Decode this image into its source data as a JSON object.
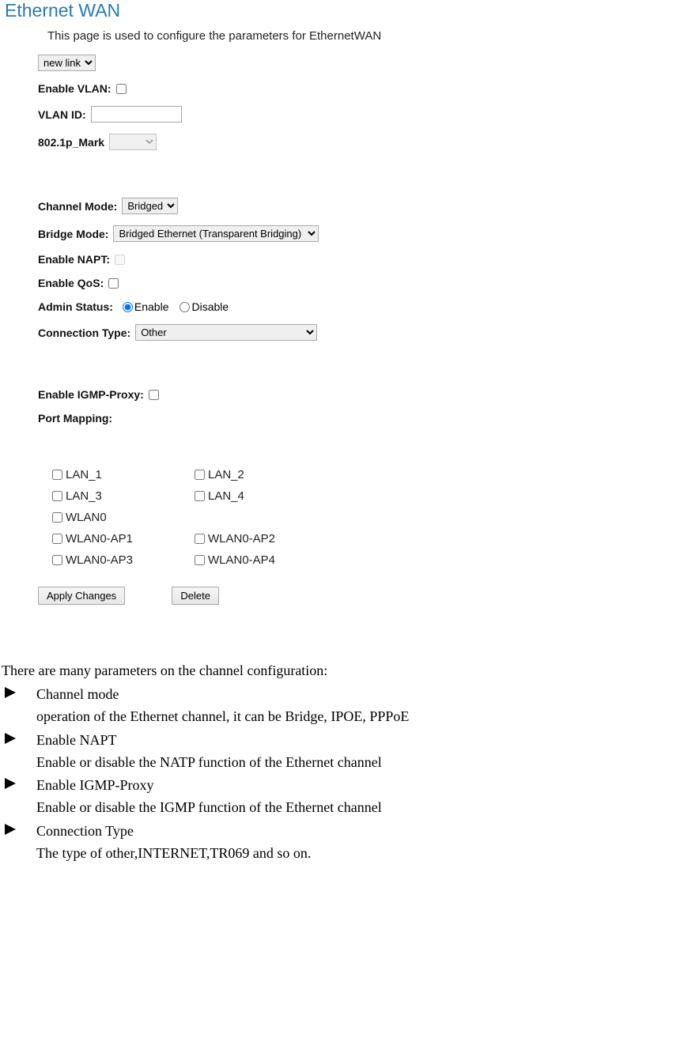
{
  "title": "Ethernet WAN",
  "description": "This page is used to configure the parameters for EthernetWAN",
  "link_select": {
    "selected": "new link"
  },
  "fields": {
    "enable_vlan_label": "Enable VLAN:",
    "vlan_id_label": "VLAN ID:",
    "mark_label": "802.1p_Mark",
    "channel_mode_label": "Channel Mode:",
    "channel_mode_value": "Bridged",
    "bridge_mode_label": "Bridge Mode:",
    "bridge_mode_value": "Bridged Ethernet (Transparent Bridging)",
    "enable_napt_label": "Enable NAPT:",
    "enable_qos_label": "Enable QoS:",
    "admin_status_label": "Admin Status:",
    "admin_enable": "Enable",
    "admin_disable": "Disable",
    "connection_type_label": "Connection Type:",
    "connection_type_value": "Other",
    "igmp_label": "Enable IGMP-Proxy:",
    "port_mapping_label": "Port Mapping:"
  },
  "port_mapping": {
    "r1c1": "LAN_1",
    "r1c2": "LAN_2",
    "r2c1": "LAN_3",
    "r2c2": "LAN_4",
    "r3c1": "WLAN0",
    "r4c1": "WLAN0-AP1",
    "r4c2": "WLAN0-AP2",
    "r5c1": "WLAN0-AP3",
    "r5c2": "WLAN0-AP4"
  },
  "buttons": {
    "apply": "Apply Changes",
    "delete": "Delete"
  },
  "doc": {
    "intro": "There are many parameters on the channel configuration:",
    "items": [
      {
        "title": "Channel mode",
        "desc": "operation of the Ethernet channel, it can be    Bridge, IPOE, PPPoE"
      },
      {
        "title": "Enable NAPT",
        "desc": "Enable or disable the NATP function of the Ethernet channel"
      },
      {
        "title": "Enable IGMP-Proxy",
        "desc": "Enable or disable the IGMP function of the Ethernet channel"
      },
      {
        "title": "Connection Type",
        "desc": "The type of other,INTERNET,TR069 and so on."
      }
    ]
  }
}
